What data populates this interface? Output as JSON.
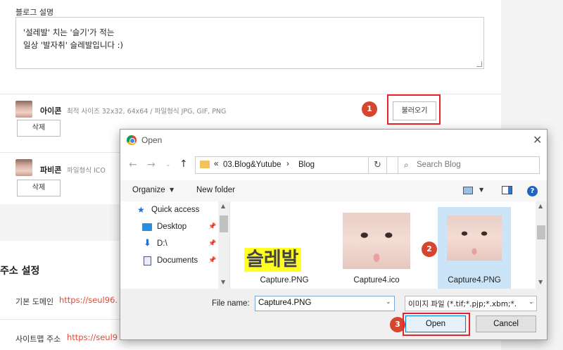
{
  "blog": {
    "description_label": "블로그 설명",
    "description_lines": [
      "'설레발' 치는 '슬기'가 적는",
      "일상 '발자취' 슬레발입니다 :)"
    ],
    "icon": {
      "title": "아이콘",
      "hint": "최적 사이즈 32x32, 64x64 / 파일형식 JPG, GIF, PNG",
      "delete_label": "삭제",
      "load_label": "불러오기"
    },
    "favicon": {
      "title": "파비콘",
      "hint": "파일형식 ICO",
      "delete_label": "삭제"
    },
    "address_section_title": "주소 설정",
    "default_domain_label": "기본 도메인",
    "default_domain_url": "https://seul96.",
    "sitemap_label": "사이트맵 주소",
    "sitemap_url": "https://seul9"
  },
  "badges": {
    "step1": "1",
    "step2": "2",
    "step3": "3"
  },
  "dialog": {
    "title": "Open",
    "close": "✕",
    "path": {
      "prefix": "«",
      "part1": "03.Blog&Yutube",
      "sep": "›",
      "part2": "Blog"
    },
    "search_placeholder": "Search Blog",
    "organize_label": "Organize",
    "new_folder_label": "New folder",
    "help": "?",
    "nav_items": [
      {
        "label": "Quick access"
      },
      {
        "label": "Desktop"
      },
      {
        "label": "D:\\"
      },
      {
        "label": "Documents"
      }
    ],
    "files": [
      {
        "name": "Capture.PNG",
        "thumb_text": "슬레발"
      },
      {
        "name": "Capture4.ico"
      },
      {
        "name": "Capture4.PNG"
      }
    ],
    "file_name_label": "File name:",
    "file_name_value": "Capture4.PNG",
    "file_type_value": "이미지 파일 (*.tif;*.pjp;*.xbm;*.",
    "open_label": "Open",
    "cancel_label": "Cancel"
  },
  "colors": {
    "accent_red": "#e3262c",
    "badge": "#d6462e",
    "url": "#e34a3a",
    "selected": "#cce4f7"
  }
}
